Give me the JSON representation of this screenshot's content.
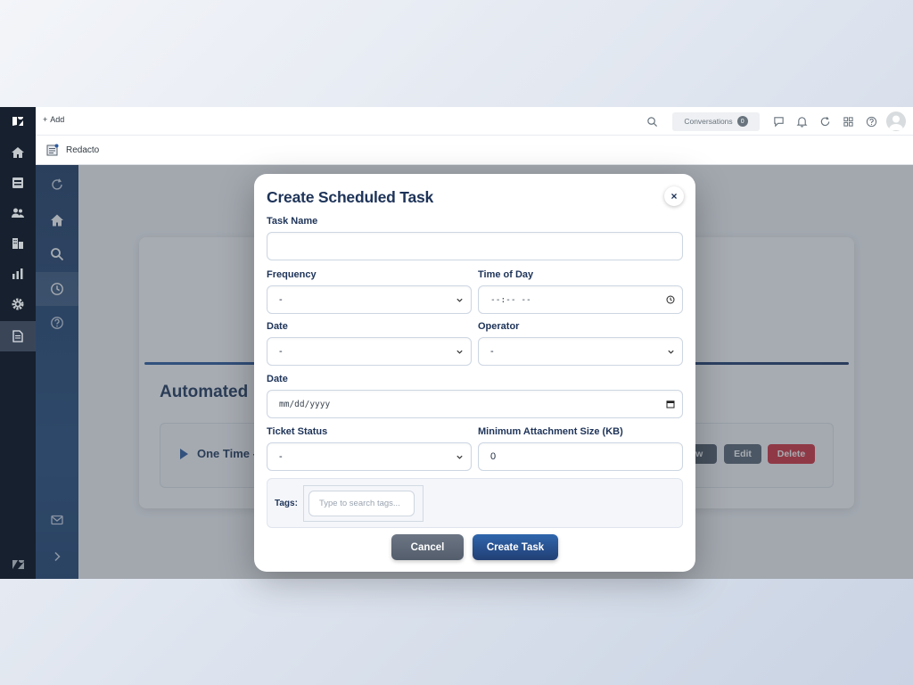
{
  "topbar": {
    "add_label": "Add",
    "conversations_label": "Conversations",
    "conversations_count": "0"
  },
  "subbar": {
    "title": "Redacto"
  },
  "background_card": {
    "title": "Automated",
    "task_name": "One Time -",
    "show_label": "ow",
    "edit_label": "Edit",
    "delete_label": "Delete"
  },
  "modal": {
    "title": "Create Scheduled Task",
    "close_glyph": "×",
    "task_name_label": "Task Name",
    "task_name_value": "",
    "frequency_label": "Frequency",
    "frequency_value": "-",
    "time_label": "Time of Day",
    "time_value": "--:-- --",
    "date_label_1": "Date",
    "date_value_1": "-",
    "operator_label": "Operator",
    "operator_value": "-",
    "date_label_2": "Date",
    "date_value_2": "mm/dd/yyyy",
    "ticket_status_label": "Ticket Status",
    "ticket_status_value": "-",
    "min_attach_label": "Minimum Attachment Size (KB)",
    "min_attach_value": "0",
    "tags_label": "Tags:",
    "tags_placeholder": "Type to search tags...",
    "cancel_label": "Cancel",
    "create_label": "Create Task"
  },
  "colors": {
    "accent": "#234a7c",
    "title": "#1d3358",
    "danger": "#d62f3b"
  }
}
